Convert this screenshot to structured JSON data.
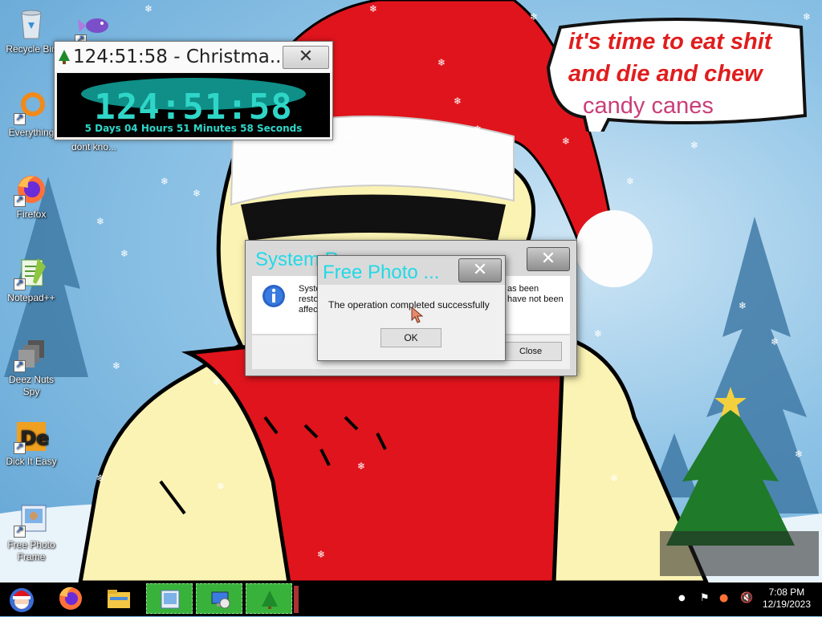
{
  "desktop": {
    "icons": [
      {
        "label": "Recycle Bin",
        "icon": "recycle-bin-icon"
      },
      {
        "label": "Everything",
        "icon": "everything-icon"
      },
      {
        "label": "Firefox",
        "icon": "firefox-icon"
      },
      {
        "label": "Notepad++",
        "icon": "notepad-plus-plus-icon"
      },
      {
        "label": "Deez Nuts Spy",
        "icon": "deez-nuts-spy-icon"
      },
      {
        "label": "Dick It Easy",
        "icon": "dick-it-easy-icon"
      },
      {
        "label": "Free Photo Frame",
        "icon": "free-photo-frame-icon"
      },
      {
        "label": "dont kno...",
        "icon": "fish-icon"
      }
    ]
  },
  "countdown": {
    "title": "124:51:58 - Christma...",
    "time": "124:51:58",
    "detail": "5 Days 04 Hours 51 Minutes 58 Seconds",
    "close": "✕"
  },
  "bubble": {
    "line1": "it's time to eat shit",
    "line2": "and die and chew",
    "line3": "candy canes"
  },
  "system_dialog": {
    "title": "System R...",
    "message_left": "Syste\nresto\naffec",
    "message_right": "as been\nhave not been",
    "close_label": "Close",
    "x": "✕"
  },
  "photo_dialog": {
    "title": "Free Photo ...",
    "message": "The operation completed successfully",
    "ok_label": "OK",
    "x": "✕"
  },
  "taskbar": {
    "start_icon": "santa-start-icon",
    "pinned": [
      "firefox-icon",
      "file-explorer-icon"
    ],
    "running": [
      "photo-frame-icon",
      "system-restore-icon",
      "christmas-tree-icon"
    ],
    "clock_time": "7:08 PM",
    "clock_date": "12/19/2023"
  },
  "colors": {
    "dialog_title": "#22d9e6",
    "countdown_digits": "#2fd6c8",
    "bubble_red": "#e01d1d",
    "bubble_pink": "#c93e78",
    "taskbar_app": "#38b23a"
  }
}
